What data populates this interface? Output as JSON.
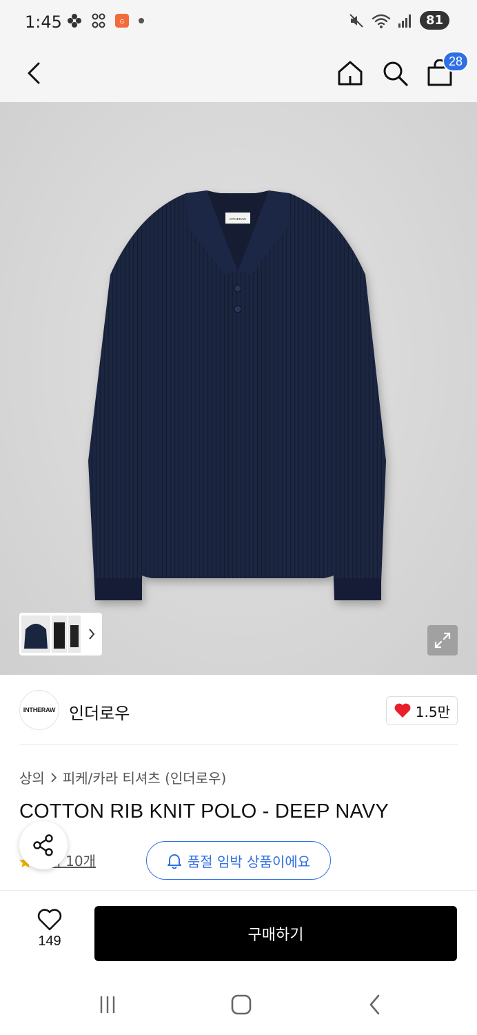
{
  "status_bar": {
    "time": "1:45",
    "battery": "81"
  },
  "header": {
    "cart_count": "28",
    "icons": [
      "back-icon",
      "home-icon",
      "search-icon",
      "shopping-bag-icon"
    ]
  },
  "product": {
    "image_label": "INTHERAW",
    "brand_logo_text": "INTHERAW",
    "brand_name": "인더로우",
    "brand_likes": "1.5만",
    "breadcrumb": [
      "상의",
      "피케/카라 티셔츠 (인더로우)"
    ],
    "title": "COTTON RIB KNIT POLO - DEEP NAVY",
    "review_link": "후기 10개",
    "soldout_notice": "품절 임박 상품이에요"
  },
  "bottom_bar": {
    "wish_count": "149",
    "buy_label": "구매하기"
  },
  "colors": {
    "accent": "#2f6fe4",
    "heart": "#e8202a",
    "garment": "#1a2540",
    "buy_button": "#000000"
  }
}
